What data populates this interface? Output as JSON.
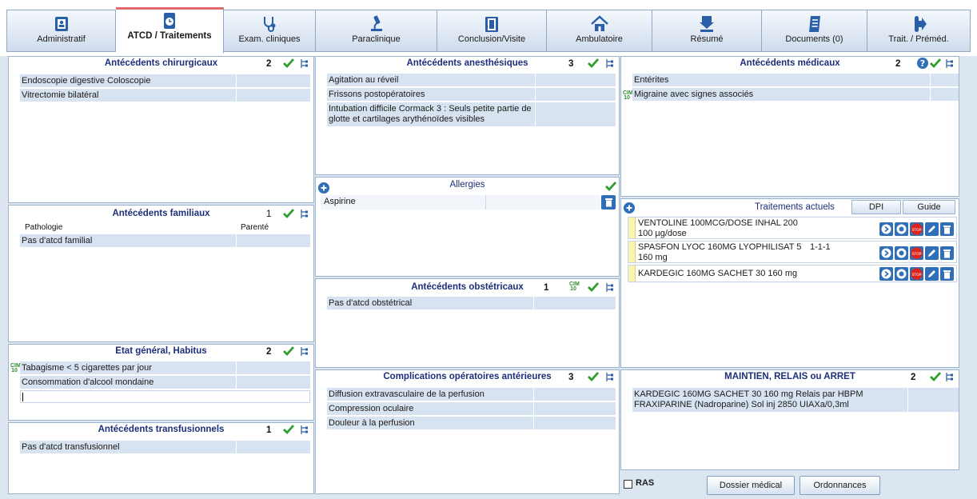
{
  "tabs": [
    {
      "label": "Administratif",
      "icon": "id-card-icon"
    },
    {
      "label": "ATCD / Traitements",
      "icon": "clock-document-icon",
      "active": true
    },
    {
      "label": "Exam. cliniques",
      "icon": "stethoscope-icon"
    },
    {
      "label": "Paraclinique",
      "icon": "microscope-icon"
    },
    {
      "label": "Conclusion/Visite",
      "icon": "folder-icon"
    },
    {
      "label": "Ambulatoire",
      "icon": "house-icon"
    },
    {
      "label": "Résumé",
      "icon": "download-icon"
    },
    {
      "label": "Documents (0)",
      "icon": "documents-icon"
    },
    {
      "label": "Trait. / Préméd.",
      "icon": "pill-arrow-icon"
    }
  ],
  "chirurgicaux": {
    "title": "Antécédents chirurgicaux",
    "count": "2",
    "rows": [
      "Endoscopie digestive Coloscopie",
      "Vitrectomie bilatéral"
    ]
  },
  "familiaux": {
    "title": "Antécédents familiaux",
    "count": "1",
    "col1": "Pathologie",
    "col2": "Parenté",
    "rows": [
      "Pas d'atcd familial"
    ]
  },
  "habitus": {
    "title": "Etat général, Habitus",
    "count": "2",
    "rows": [
      "Tabagisme < 5 cigarettes par jour",
      "Consommation d'alcool mondaine"
    ]
  },
  "transfusionnels": {
    "title": "Antécédents transfusionnels",
    "count": "1",
    "rows": [
      "Pas d'atcd transfusionnel"
    ]
  },
  "anesthesiques": {
    "title": "Antécédents anesthésiques",
    "count": "3",
    "rows": [
      "Agitation au réveil",
      "Frissons postopératoires",
      "Intubation difficile Cormack 3 : Seuls petite partie de glotte et cartilages arythénoïdes visibles"
    ]
  },
  "allergies": {
    "title": "Allergies",
    "rows": [
      "Aspirine"
    ]
  },
  "obstetricaux": {
    "title": "Antécédents obstétricaux",
    "count": "1",
    "rows": [
      "Pas d'atcd obstétrical"
    ]
  },
  "complications": {
    "title": "Complications opératoires antérieures",
    "count": "3",
    "rows": [
      "Diffusion extravasculaire de la perfusion",
      "Compression oculaire",
      "Douleur à la perfusion"
    ]
  },
  "medicaux": {
    "title": "Antécédents médicaux",
    "count": "2",
    "rows": [
      "Entérites",
      "Migraine avec signes associés"
    ]
  },
  "traitements": {
    "title": "Traitements actuels",
    "dpi": "DPI",
    "guide": "Guide",
    "rows": [
      {
        "name": "VENTOLINE 100MCG/DOSE INHAL 200 100 µg/dose",
        "dose": ""
      },
      {
        "name": "SPASFON LYOC 160MG LYOPHILISAT 5 160 mg",
        "dose": "1-1-1"
      },
      {
        "name": "KARDEGIC 160MG SACHET 30 160 mg",
        "dose": ""
      }
    ]
  },
  "maintien": {
    "title": "MAINTIEN, RELAIS ou ARRET",
    "count": "2",
    "text": "KARDEGIC 160MG SACHET 30 160 mg Relais par HBPM FRAXIPARINE (Nadroparine) Sol inj 2850 UIAXa/0,3ml"
  },
  "footer": {
    "ras": "RAS",
    "dossier": "Dossier médical",
    "ordonnances": "Ordonnances"
  },
  "colors": {
    "title": "#1d2f7a",
    "row": "#d8e3f2",
    "check": "#2f9e2f",
    "action": "#2f6fb8",
    "stop": "#d9251d"
  }
}
